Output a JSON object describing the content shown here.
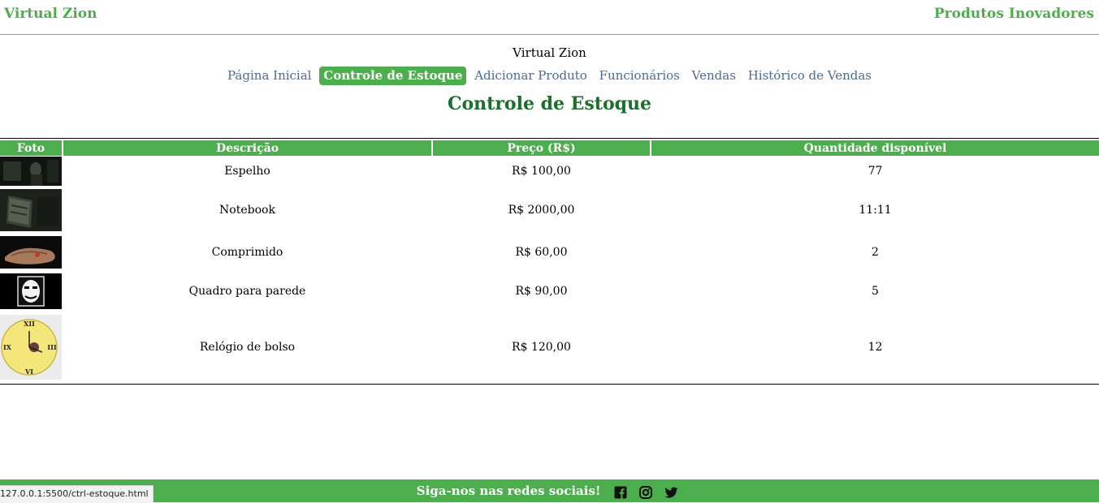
{
  "header": {
    "brand_left": "Virtual Zion",
    "brand_right": "Produtos Inovadores"
  },
  "site_name": "Virtual Zion",
  "nav": {
    "items": [
      {
        "label": "Página Inicial"
      },
      {
        "label": "Controle de Estoque"
      },
      {
        "label": "Adicionar Produto"
      },
      {
        "label": "Funcionários"
      },
      {
        "label": "Vendas"
      },
      {
        "label": "Histórico de Vendas"
      }
    ],
    "active": "Controle de Estoque"
  },
  "page_title": "Controle de Estoque",
  "table": {
    "headers": [
      "Foto",
      "Descrição",
      "Preço (R$)",
      "Quantidade disponível"
    ],
    "rows": [
      {
        "descricao": "Espelho",
        "preco": "R$ 100,00",
        "quantidade": "77"
      },
      {
        "descricao": "Notebook",
        "preco": "R$ 2000,00",
        "quantidade": "11:11"
      },
      {
        "descricao": "Comprimido",
        "preco": "R$ 60,00",
        "quantidade": "2"
      },
      {
        "descricao": "Quadro para parede",
        "preco": "R$ 90,00",
        "quantidade": "5"
      },
      {
        "descricao": "Relógio de bolso",
        "preco": "R$ 120,00",
        "quantidade": "12"
      }
    ]
  },
  "footer": {
    "text": "Siga-nos nas redes sociais!",
    "icons": [
      "facebook-icon",
      "instagram-icon",
      "twitter-icon"
    ]
  },
  "status_url": "127.0.0.1:5500/ctrl-estoque.html",
  "colors": {
    "accent": "#4cae4c",
    "title": "#1b6e2b",
    "link": "#4a6a9a"
  }
}
